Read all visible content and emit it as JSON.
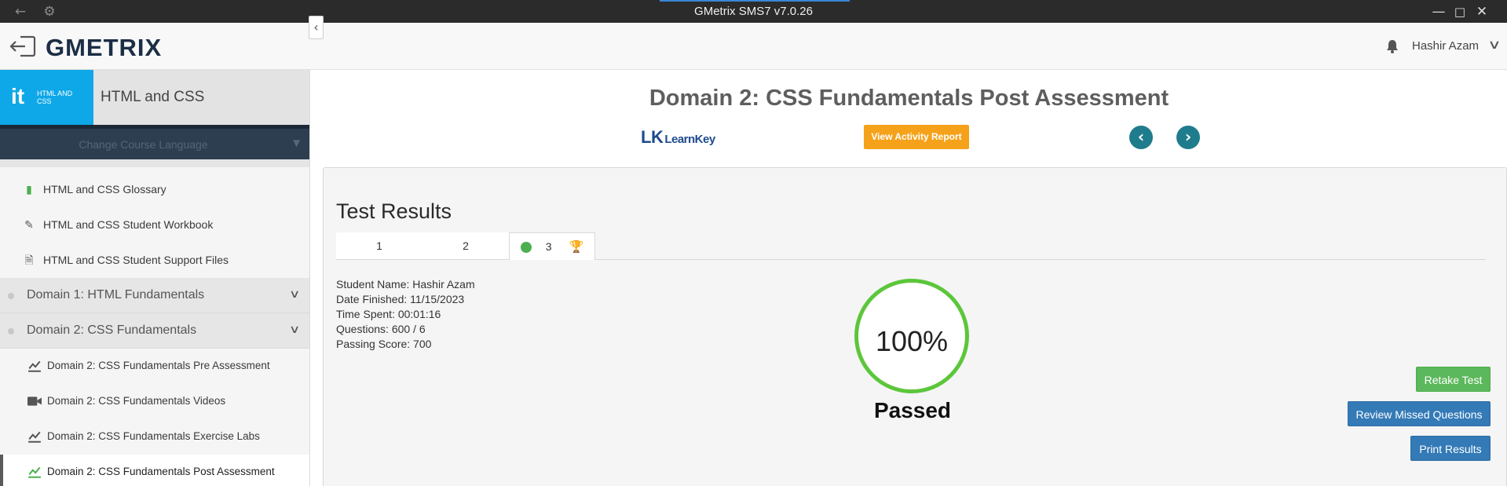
{
  "window": {
    "title": "GMetrix SMS7 v7.0.26"
  },
  "header": {
    "brand": "GMETRIX",
    "user_name": "Hashir Azam"
  },
  "sidebar": {
    "course_badge_label": "HTML AND CSS",
    "course_title": "HTML and CSS",
    "language_select": "Change Course Language",
    "items": [
      {
        "label": "HTML and CSS Glossary",
        "icon": "book-icon",
        "type": "resource"
      },
      {
        "label": "HTML and CSS Student Workbook",
        "icon": "pencil-icon",
        "type": "resource"
      },
      {
        "label": "HTML and CSS Student Support Files",
        "icon": "file-icon",
        "type": "resource"
      },
      {
        "label": "Domain 1: HTML Fundamentals",
        "icon": "chevron-down-icon",
        "type": "domain"
      },
      {
        "label": "Domain 2: CSS Fundamentals",
        "icon": "chevron-down-icon",
        "type": "domain"
      },
      {
        "label": "Domain 2: CSS Fundamentals Pre Assessment",
        "icon": "chart-icon",
        "type": "lesson"
      },
      {
        "label": "Domain 2: CSS Fundamentals Videos",
        "icon": "video-icon",
        "type": "lesson"
      },
      {
        "label": "Domain 2: CSS Fundamentals Exercise Labs",
        "icon": "chart-icon",
        "type": "lesson"
      },
      {
        "label": "Domain 2: CSS Fundamentals Post Assessment",
        "icon": "chart-icon",
        "type": "lesson",
        "active": true
      }
    ]
  },
  "main": {
    "page_title": "Domain 2: CSS Fundamentals Post Assessment",
    "partner_logo": "LearnKey",
    "view_report_label": "View Activity Report",
    "results": {
      "title": "Test Results",
      "tabs": [
        "1",
        "2",
        "3"
      ],
      "student_name": "Student Name: Hashir Azam",
      "date_finished": "Date Finished: 11/15/2023",
      "time_spent": "Time Spent: 00:01:16",
      "questions": "Questions: 600 / 6",
      "passing_score": "Passing Score: 700",
      "score_percent": "100%",
      "score_fraction": 1.0,
      "status": "Passed"
    },
    "buttons": {
      "retake": "Retake Test",
      "review": "Review Missed Questions",
      "print": "Print Results"
    }
  },
  "colors": {
    "accent_orange": "#f5a21a",
    "nav_teal": "#1f7c8c",
    "pass_green": "#5cc63b",
    "badge_blue": "#0ea8e8"
  }
}
